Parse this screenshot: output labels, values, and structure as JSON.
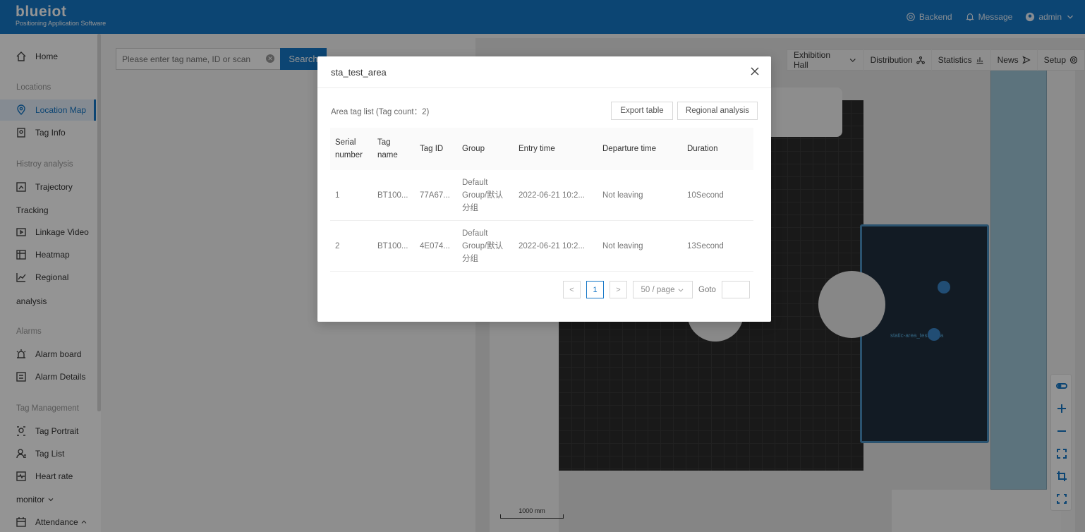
{
  "header": {
    "logo_name": "blueiot",
    "logo_sub": "Positioning Application Software",
    "backend": "Backend",
    "message": "Message",
    "user": "admin"
  },
  "sidebar": {
    "home": "Home",
    "section_locations": "Locations",
    "location_map": "Location Map",
    "tag_info": "Tag Info",
    "section_history": "Histroy analysis",
    "trajectory": "Trajectory",
    "tracking": "Tracking",
    "linkage_video": "Linkage Video",
    "heatmap": "Heatmap",
    "regional": "Regional",
    "analysis": "analysis",
    "section_alarms": "Alarms",
    "alarm_board": "Alarm board",
    "alarm_details": "Alarm Details",
    "section_tag_mgmt": "Tag Management",
    "tag_portrait": "Tag Portrait",
    "tag_list": "Tag List",
    "heart_rate": "Heart rate",
    "monitor": "monitor",
    "attendance": "Attendance"
  },
  "search": {
    "placeholder": "Please enter tag name, ID or scan",
    "button": "Search"
  },
  "map_toolbar": {
    "exhibition_hall": "Exhibition Hall",
    "distribution": "Distribution",
    "statistics": "Statistics",
    "news": "News",
    "setup": "Setup"
  },
  "map": {
    "area_label": "static-area_test_area",
    "scale": "1000 mm"
  },
  "modal": {
    "title": "sta_test_area",
    "tag_list_label": "Area tag list (Tag count：2)",
    "export_btn": "Export table",
    "regional_btn": "Regional analysis",
    "columns": {
      "serial": "Serial number",
      "tag_name": "Tag name",
      "tag_id": "Tag ID",
      "group": "Group",
      "entry": "Entry time",
      "departure": "Departure time",
      "duration": "Duration"
    },
    "rows": [
      {
        "serial": "1",
        "tag_name": "BT100...",
        "tag_id": "77A67...",
        "group": "Default Group/默认分组",
        "entry": "2022-06-21 10:2...",
        "departure": "Not leaving",
        "duration": "10Second"
      },
      {
        "serial": "2",
        "tag_name": "BT100...",
        "tag_id": "4E074...",
        "group": "Default Group/默认分组",
        "entry": "2022-06-21 10:2...",
        "departure": "Not leaving",
        "duration": "13Second"
      }
    ],
    "pager": {
      "prev": "<",
      "current": "1",
      "next": ">",
      "page_size": "50 / page",
      "goto": "Goto"
    }
  }
}
